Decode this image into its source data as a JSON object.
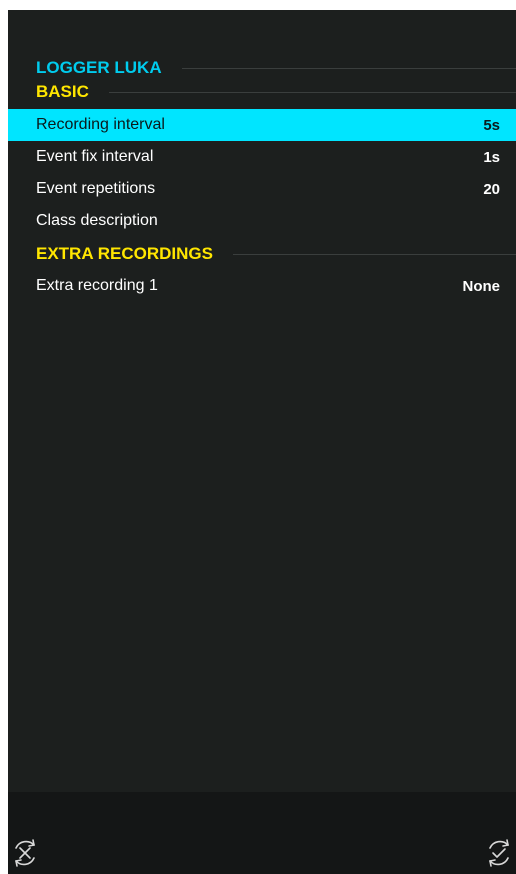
{
  "header": {
    "device_title": "LOGGER LUKA"
  },
  "sections": {
    "basic": {
      "title": "BASIC",
      "rows": [
        {
          "label": "Recording interval",
          "value": "5s"
        },
        {
          "label": "Event fix interval",
          "value": "1s"
        },
        {
          "label": "Event repetitions",
          "value": "20"
        },
        {
          "label": "Class description",
          "value": ""
        }
      ]
    },
    "extra": {
      "title": "EXTRA RECORDINGS",
      "rows": [
        {
          "label": "Extra recording 1",
          "value": "None"
        }
      ]
    }
  },
  "bottom_bar": {
    "left_icon": "cancel-sync-icon",
    "right_icon": "confirm-sync-icon"
  },
  "colors": {
    "background": "#1c1f1e",
    "selected_row": "#00e5ff",
    "header_cyan": "#00ccee",
    "header_yellow": "#ffe600"
  }
}
